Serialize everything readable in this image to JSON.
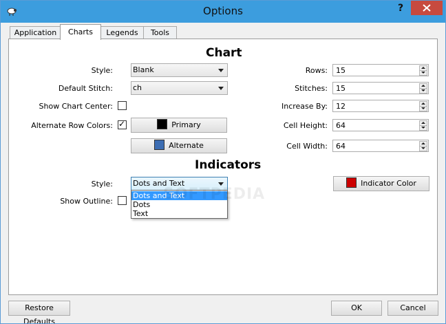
{
  "window": {
    "title": "Options",
    "help_label": "?",
    "icons": {
      "app": "sheep-icon",
      "close": "close-icon"
    }
  },
  "tabs": [
    {
      "label": "Application",
      "active": false
    },
    {
      "label": "Charts",
      "active": true
    },
    {
      "label": "Legends",
      "active": false
    },
    {
      "label": "Tools",
      "active": false
    }
  ],
  "chart_section": {
    "heading": "Chart",
    "style": {
      "label": "Style:",
      "value": "Blank"
    },
    "default_stitch": {
      "label": "Default Stitch:",
      "value": "ch"
    },
    "show_chart_center": {
      "label": "Show Chart Center:",
      "checked": false
    },
    "alternate_row_colors": {
      "label": "Alternate Row Colors:",
      "checked": true,
      "mark": "✓"
    },
    "primary_button": {
      "label": "Primary",
      "color": "#000000"
    },
    "alternate_button": {
      "label": "Alternate",
      "color": "#3c6db3"
    },
    "rows": {
      "label": "Rows:",
      "value": "15"
    },
    "stitches": {
      "label": "Stitches:",
      "value": "15"
    },
    "increase_by": {
      "label": "Increase By:",
      "value": "12"
    },
    "cell_height": {
      "label": "Cell Height:",
      "value": "64"
    },
    "cell_width": {
      "label": "Cell Width:",
      "value": "64"
    }
  },
  "indicators_section": {
    "heading": "Indicators",
    "style": {
      "label": "Style:",
      "value": "Dots and Text",
      "options": [
        "Dots and Text",
        "Dots",
        "Text"
      ],
      "selected_index": 0
    },
    "show_outline": {
      "label": "Show Outline:",
      "checked": false
    },
    "indicator_color_button": {
      "label": "Indicator Color",
      "color": "#cc0000"
    }
  },
  "footer": {
    "restore_defaults": "Restore Defaults",
    "ok": "OK",
    "cancel": "Cancel"
  },
  "watermark": "SOFTPEDIA"
}
